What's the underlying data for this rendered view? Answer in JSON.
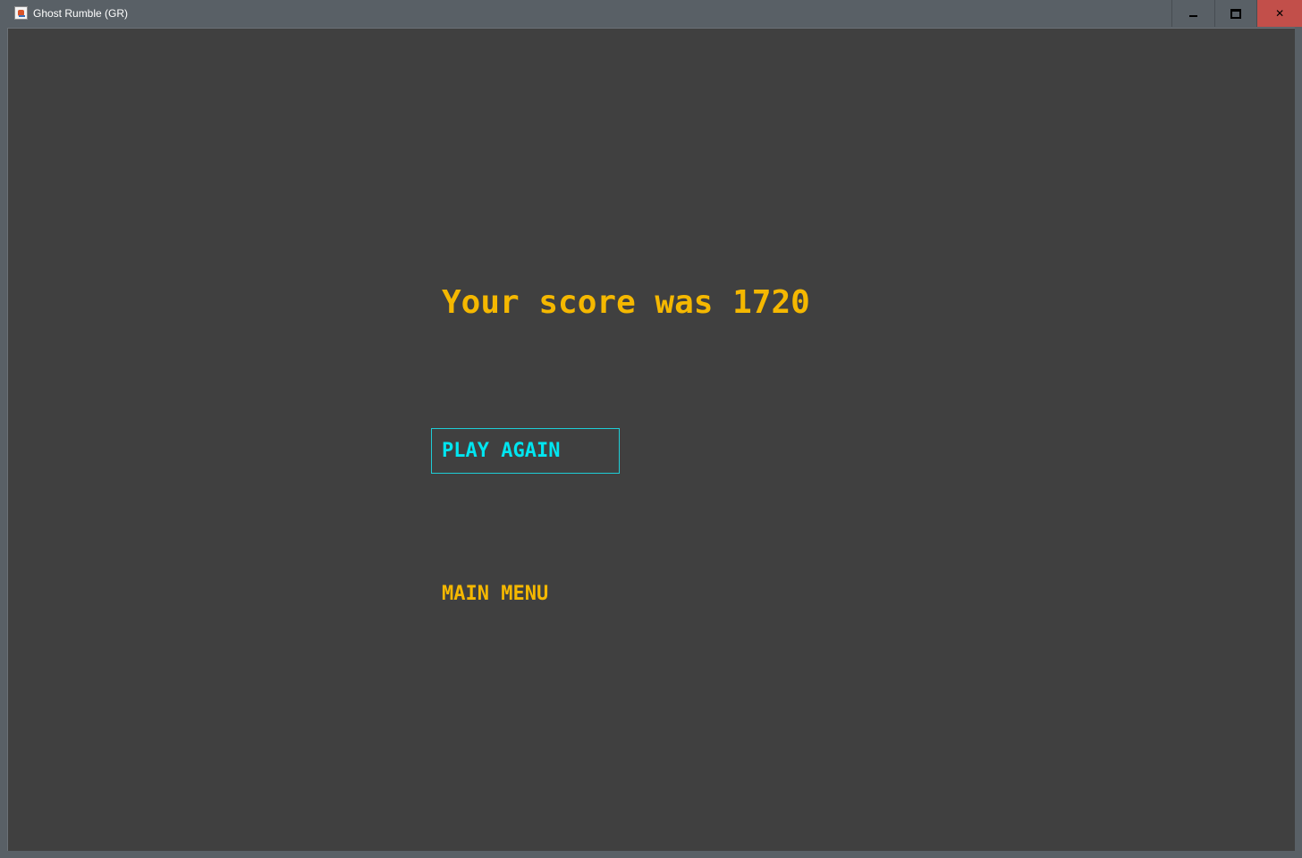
{
  "window": {
    "title": "Ghost Rumble (GR)",
    "icon": "java-cup-icon",
    "controls": {
      "minimize": "minimize-icon",
      "maximize": "maximize-icon",
      "close_label": "✕"
    }
  },
  "game_over": {
    "score_text": "Your score was 1720",
    "menu": [
      {
        "label": "PLAY AGAIN",
        "selected": true
      },
      {
        "label": "MAIN MENU",
        "selected": false
      }
    ]
  },
  "colors": {
    "background": "#404040",
    "text_primary": "#f5b800",
    "text_selected": "#00e5f0",
    "selection_border": "#1ecdd6",
    "titlebar": "#596066",
    "close_button": "#c24f4a"
  }
}
